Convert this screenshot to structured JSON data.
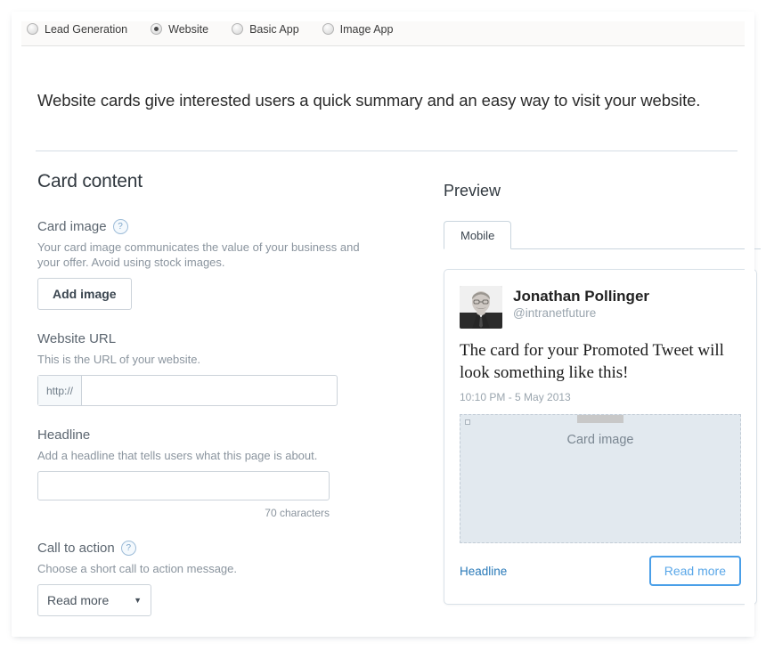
{
  "card_type_options": [
    {
      "label": "Lead Generation",
      "selected": false
    },
    {
      "label": "Website",
      "selected": true
    },
    {
      "label": "Basic App",
      "selected": false
    },
    {
      "label": "Image App",
      "selected": false
    }
  ],
  "intro": {
    "text": "Website cards give interested users a quick summary and an easy way to visit your website."
  },
  "card_content": {
    "title": "Card content",
    "card_image": {
      "label": "Card image",
      "help_icon": "question-mark-icon",
      "description": "Your card image communicates the value of your business and your offer. Avoid using stock images.",
      "button_label": "Add image"
    },
    "website_url": {
      "label": "Website URL",
      "description": "This is the URL of your website.",
      "prefix": "http://",
      "value": "",
      "placeholder": ""
    },
    "headline": {
      "label": "Headline",
      "description": "Add a headline that tells users what this page is about.",
      "value": "",
      "placeholder": "",
      "char_count": "70 characters"
    },
    "call_to_action": {
      "label": "Call to action",
      "help_icon": "question-mark-icon",
      "description": "Choose a short call to action message.",
      "selected": "Read more",
      "caret": "▼"
    }
  },
  "preview": {
    "title": "Preview",
    "tabs": [
      {
        "label": "Mobile",
        "active": true
      }
    ],
    "tweet": {
      "avatar": "user-avatar-photo",
      "display_name": "Jonathan Pollinger",
      "handle": "@intranetfuture",
      "body": "The card for your Promoted Tweet will look something like this!",
      "timestamp": "10:10 PM - 5 May 2013",
      "card_image_placeholder": "Card image",
      "headline_link": "Headline",
      "cta_label": "Read more"
    }
  },
  "colors": {
    "header_bg": "#fbfaf9",
    "rule": "#d5dde4",
    "link_blue": "#2a7ab9",
    "cta_blue": "#4a9fe8",
    "placeholder_bg": "#e2e9ef",
    "muted_text": "#8a949e"
  }
}
